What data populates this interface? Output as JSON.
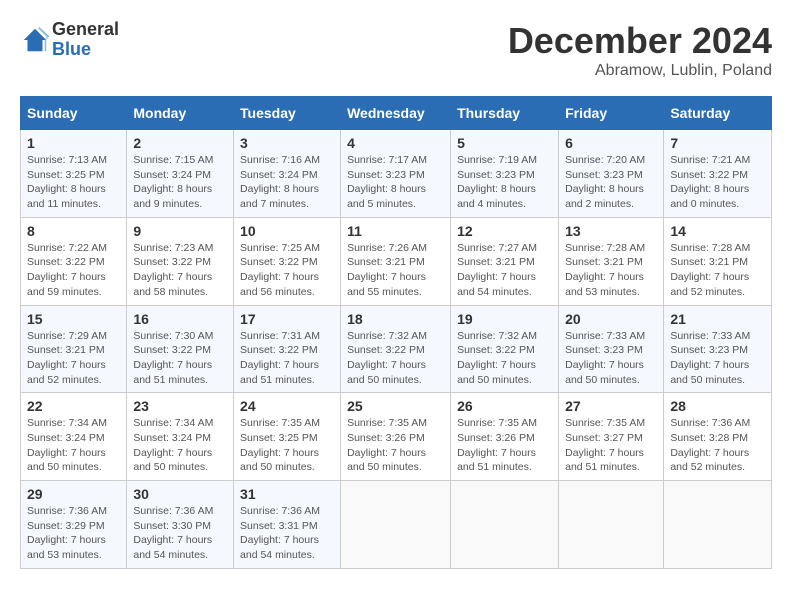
{
  "logo": {
    "general": "General",
    "blue": "Blue"
  },
  "title": {
    "month": "December 2024",
    "location": "Abramow, Lublin, Poland"
  },
  "headers": [
    "Sunday",
    "Monday",
    "Tuesday",
    "Wednesday",
    "Thursday",
    "Friday",
    "Saturday"
  ],
  "weeks": [
    [
      {
        "day": "1",
        "sunrise": "7:13 AM",
        "sunset": "3:25 PM",
        "daylight": "8 hours and 11 minutes."
      },
      {
        "day": "2",
        "sunrise": "7:15 AM",
        "sunset": "3:24 PM",
        "daylight": "8 hours and 9 minutes."
      },
      {
        "day": "3",
        "sunrise": "7:16 AM",
        "sunset": "3:24 PM",
        "daylight": "8 hours and 7 minutes."
      },
      {
        "day": "4",
        "sunrise": "7:17 AM",
        "sunset": "3:23 PM",
        "daylight": "8 hours and 5 minutes."
      },
      {
        "day": "5",
        "sunrise": "7:19 AM",
        "sunset": "3:23 PM",
        "daylight": "8 hours and 4 minutes."
      },
      {
        "day": "6",
        "sunrise": "7:20 AM",
        "sunset": "3:23 PM",
        "daylight": "8 hours and 2 minutes."
      },
      {
        "day": "7",
        "sunrise": "7:21 AM",
        "sunset": "3:22 PM",
        "daylight": "8 hours and 0 minutes."
      }
    ],
    [
      {
        "day": "8",
        "sunrise": "7:22 AM",
        "sunset": "3:22 PM",
        "daylight": "7 hours and 59 minutes."
      },
      {
        "day": "9",
        "sunrise": "7:23 AM",
        "sunset": "3:22 PM",
        "daylight": "7 hours and 58 minutes."
      },
      {
        "day": "10",
        "sunrise": "7:25 AM",
        "sunset": "3:22 PM",
        "daylight": "7 hours and 56 minutes."
      },
      {
        "day": "11",
        "sunrise": "7:26 AM",
        "sunset": "3:21 PM",
        "daylight": "7 hours and 55 minutes."
      },
      {
        "day": "12",
        "sunrise": "7:27 AM",
        "sunset": "3:21 PM",
        "daylight": "7 hours and 54 minutes."
      },
      {
        "day": "13",
        "sunrise": "7:28 AM",
        "sunset": "3:21 PM",
        "daylight": "7 hours and 53 minutes."
      },
      {
        "day": "14",
        "sunrise": "7:28 AM",
        "sunset": "3:21 PM",
        "daylight": "7 hours and 52 minutes."
      }
    ],
    [
      {
        "day": "15",
        "sunrise": "7:29 AM",
        "sunset": "3:21 PM",
        "daylight": "7 hours and 52 minutes."
      },
      {
        "day": "16",
        "sunrise": "7:30 AM",
        "sunset": "3:22 PM",
        "daylight": "7 hours and 51 minutes."
      },
      {
        "day": "17",
        "sunrise": "7:31 AM",
        "sunset": "3:22 PM",
        "daylight": "7 hours and 51 minutes."
      },
      {
        "day": "18",
        "sunrise": "7:32 AM",
        "sunset": "3:22 PM",
        "daylight": "7 hours and 50 minutes."
      },
      {
        "day": "19",
        "sunrise": "7:32 AM",
        "sunset": "3:22 PM",
        "daylight": "7 hours and 50 minutes."
      },
      {
        "day": "20",
        "sunrise": "7:33 AM",
        "sunset": "3:23 PM",
        "daylight": "7 hours and 50 minutes."
      },
      {
        "day": "21",
        "sunrise": "7:33 AM",
        "sunset": "3:23 PM",
        "daylight": "7 hours and 50 minutes."
      }
    ],
    [
      {
        "day": "22",
        "sunrise": "7:34 AM",
        "sunset": "3:24 PM",
        "daylight": "7 hours and 50 minutes."
      },
      {
        "day": "23",
        "sunrise": "7:34 AM",
        "sunset": "3:24 PM",
        "daylight": "7 hours and 50 minutes."
      },
      {
        "day": "24",
        "sunrise": "7:35 AM",
        "sunset": "3:25 PM",
        "daylight": "7 hours and 50 minutes."
      },
      {
        "day": "25",
        "sunrise": "7:35 AM",
        "sunset": "3:26 PM",
        "daylight": "7 hours and 50 minutes."
      },
      {
        "day": "26",
        "sunrise": "7:35 AM",
        "sunset": "3:26 PM",
        "daylight": "7 hours and 51 minutes."
      },
      {
        "day": "27",
        "sunrise": "7:35 AM",
        "sunset": "3:27 PM",
        "daylight": "7 hours and 51 minutes."
      },
      {
        "day": "28",
        "sunrise": "7:36 AM",
        "sunset": "3:28 PM",
        "daylight": "7 hours and 52 minutes."
      }
    ],
    [
      {
        "day": "29",
        "sunrise": "7:36 AM",
        "sunset": "3:29 PM",
        "daylight": "7 hours and 53 minutes."
      },
      {
        "day": "30",
        "sunrise": "7:36 AM",
        "sunset": "3:30 PM",
        "daylight": "7 hours and 54 minutes."
      },
      {
        "day": "31",
        "sunrise": "7:36 AM",
        "sunset": "3:31 PM",
        "daylight": "7 hours and 54 minutes."
      },
      null,
      null,
      null,
      null
    ]
  ],
  "labels": {
    "sunrise": "Sunrise: ",
    "sunset": "Sunset: ",
    "daylight": "Daylight: "
  }
}
